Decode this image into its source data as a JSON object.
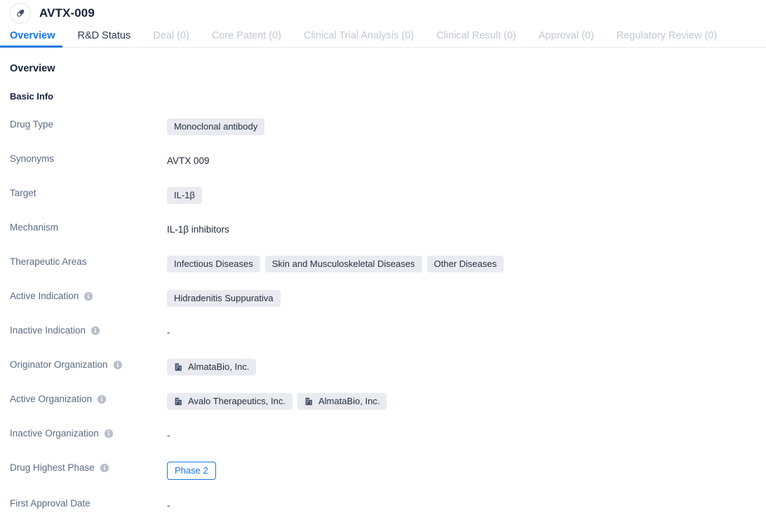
{
  "header": {
    "title": "AVTX-009",
    "avatar_icon": "pill-icon"
  },
  "tabs": [
    {
      "label": "Overview",
      "state": "active"
    },
    {
      "label": "R&D Status",
      "state": "enabled"
    },
    {
      "label": "Deal (0)",
      "state": "disabled"
    },
    {
      "label": "Core Patent (0)",
      "state": "disabled"
    },
    {
      "label": "Clinical Trial Analysis (0)",
      "state": "disabled"
    },
    {
      "label": "Clinical Result (0)",
      "state": "disabled"
    },
    {
      "label": "Approval (0)",
      "state": "disabled"
    },
    {
      "label": "Regulatory Review (0)",
      "state": "disabled"
    }
  ],
  "overview": {
    "section_title": "Overview",
    "subsection_title": "Basic Info",
    "fields": [
      {
        "label": "Drug Type",
        "has_info": false,
        "type": "chips",
        "values": [
          "Monoclonal antibody"
        ]
      },
      {
        "label": "Synonyms",
        "has_info": false,
        "type": "text",
        "values": [
          "AVTX 009"
        ]
      },
      {
        "label": "Target",
        "has_info": false,
        "type": "chips",
        "values": [
          "IL-1β"
        ]
      },
      {
        "label": "Mechanism",
        "has_info": false,
        "type": "text",
        "values": [
          "IL-1β inhibitors"
        ]
      },
      {
        "label": "Therapeutic Areas",
        "has_info": false,
        "type": "chips",
        "values": [
          "Infectious Diseases",
          "Skin and Musculoskeletal Diseases",
          "Other Diseases"
        ]
      },
      {
        "label": "Active Indication",
        "has_info": true,
        "type": "chips",
        "values": [
          "Hidradenitis Suppurativa"
        ]
      },
      {
        "label": "Inactive Indication",
        "has_info": true,
        "type": "empty",
        "values": [
          "-"
        ]
      },
      {
        "label": "Originator Organization",
        "has_info": true,
        "type": "org-chips",
        "values": [
          "AlmataBio, Inc."
        ]
      },
      {
        "label": "Active Organization",
        "has_info": true,
        "type": "org-chips",
        "values": [
          "Avalo Therapeutics, Inc.",
          "AlmataBio, Inc."
        ]
      },
      {
        "label": "Inactive Organization",
        "has_info": true,
        "type": "empty",
        "values": [
          "-"
        ]
      },
      {
        "label": "Drug Highest Phase",
        "has_info": true,
        "type": "phase",
        "values": [
          "Phase 2"
        ]
      },
      {
        "label": "First Approval Date",
        "has_info": false,
        "type": "empty",
        "values": [
          "-"
        ]
      }
    ]
  },
  "colors": {
    "accent": "#1677e0",
    "label": "#5a6b82",
    "chip_bg": "#e9ebf0",
    "title": "#16213a",
    "disabled_tab": "#c2c8d4"
  }
}
